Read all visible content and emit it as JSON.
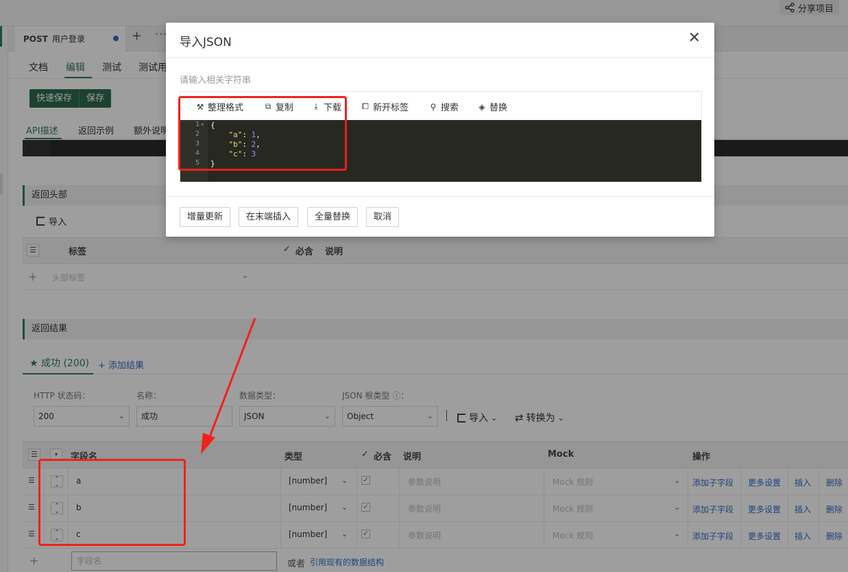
{
  "topbar": {
    "share_label": "分享项目"
  },
  "api_tab": {
    "method": "POST",
    "name": "用户登录",
    "add": "+",
    "more": "···"
  },
  "subtabs": [
    "文档",
    "编辑",
    "测试",
    "测试用"
  ],
  "save": {
    "quick": "快速保存",
    "save": "保存"
  },
  "desc_tabs": [
    "API描述",
    "返回示例",
    "额外说明"
  ],
  "headers_section": {
    "title": "返回头部",
    "import_label": "导入",
    "columns": {
      "label": "标签",
      "required": "必含",
      "desc": "说明"
    },
    "placeholder": "头部标签"
  },
  "result_section": {
    "title": "返回结果",
    "tab_label": "成功 (200)",
    "add_result": "+ 添加结果",
    "labels": {
      "http": "HTTP 状态码：",
      "name": "名称：",
      "dtype": "数据类型：",
      "json_root": "JSON 根类型 ⓘ："
    },
    "values": {
      "http": "200",
      "name": "成功",
      "dtype": "JSON",
      "json_root": "Object"
    },
    "import_label": "导入",
    "convert_label": "转换为"
  },
  "fields_table": {
    "columns": {
      "name": "字段名",
      "type": "类型",
      "required": "必含",
      "desc": "说明",
      "mock": "Mock",
      "ops": "操作"
    },
    "rows": [
      {
        "name": "a",
        "type": "[number]",
        "desc_ph": "参数说明",
        "mock_ph": "Mock 规则"
      },
      {
        "name": "b",
        "type": "[number]",
        "desc_ph": "参数说明",
        "mock_ph": "Mock 规则"
      },
      {
        "name": "c",
        "type": "[number]",
        "desc_ph": "参数说明",
        "mock_ph": "Mock 规则"
      }
    ],
    "ops": {
      "add_child": "添加子字段",
      "more": "更多设置",
      "insert": "插入",
      "delete": "删除"
    },
    "new_field_placeholder": "字段名",
    "or_text": "或者",
    "ref_link": "引用现有的数据结构"
  },
  "modal": {
    "title": "导入JSON",
    "hint": "请输入相关字符串",
    "toolbar": {
      "format": "整理格式",
      "copy": "复制",
      "download": "下载",
      "new_tab": "新开标签",
      "search": "搜索",
      "replace": "替换"
    },
    "code_lines": [
      "{",
      "    \"a\": 1,",
      "    \"b\": 2,",
      "    \"c\": 3",
      "}"
    ],
    "buttons": {
      "incremental": "增量更新",
      "append": "在末端插入",
      "replace_all": "全量替换",
      "cancel": "取消"
    }
  },
  "colors": {
    "accent": "#2e7d5b",
    "link": "#2f6fc8",
    "annotation": "#f2201a",
    "editor_bg": "#272822"
  }
}
